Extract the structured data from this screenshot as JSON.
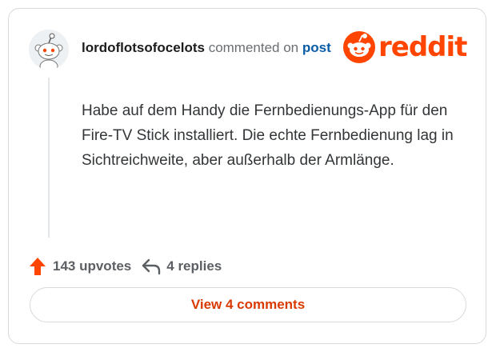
{
  "comment": {
    "username": "lordoflotsofocelots",
    "action_text": "commented on",
    "post_link": "post",
    "body": "Habe auf dem Handy die Fernbedienungs-App für den Fire-TV Stick installiert. Die echte Fernbedienung lag in Sichtreichweite, aber außerhalb der Armlänge.",
    "upvotes": "143 upvotes",
    "replies": "4 replies",
    "view_comments": "View 4 comments"
  },
  "brand": {
    "name": "reddit",
    "icon": "reddit-snoo-icon"
  },
  "colors": {
    "brand": "#ff4500",
    "link": "#0a5ca8",
    "button_text": "#d93a00",
    "upvote": "#ff4500"
  }
}
